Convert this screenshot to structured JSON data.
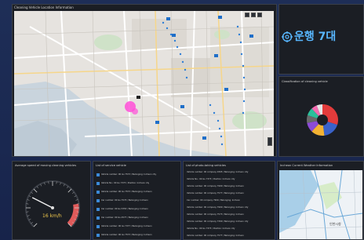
{
  "map": {
    "title": "Cleaning Vehicle Location Information",
    "colors": {
      "route": "#2f7fd6",
      "highlight": "#ff4fd8",
      "marker": "#1f6fc9"
    }
  },
  "ops": {
    "label": "운행 7대",
    "icon": "target-icon",
    "color": "#58b7ff"
  },
  "classification": {
    "title": "Classification of cleaning vehicle",
    "chart_data": {
      "type": "pie",
      "values": [
        30,
        18,
        14,
        10,
        8,
        8,
        6,
        6
      ],
      "colors": [
        "#e23b3b",
        "#3a62c9",
        "#f3b233",
        "#8c4bd6",
        "#6a6a6a",
        "#2bbf9b",
        "#f26bb0",
        "#e6e6e6"
      ]
    }
  },
  "speed": {
    "title": "Average speed of moving cleaning vehicles",
    "value": 16,
    "unit": "km/h",
    "display": "16 km/h",
    "max": 60,
    "accent": "#e05a5a"
  },
  "service": {
    "title": "List of service vehicle",
    "rows": [
      "Vehicle number: 00 Gu 7573 / Belonging: Incheon city",
      "Vehicle No.: 00 Gu 7373 / Position: Incheon city",
      "Vehicle number: 00 Gu 7573 / Belonging: Incheon",
      "Car number: 00 Gu 7573 / Belonging: Incheon",
      "Car number: 00 Gu 5353 / Belonging: Incheon",
      "Car number: 00 Gu 4577 / Belonging: Incheon",
      "Vehicle number: 00 Gu 7377 / Belonging: Incheon",
      "Vehicle number: 00 Gu 7573 / Belonging: Incheon"
    ]
  },
  "photo": {
    "title": "List of photo-taking vehicles",
    "rows": [
      "Vehicle number: 00 company 0305 / Belonging: Incheon city",
      "Vehicle No.: 00 Gu 7373 / Position: Incheon city",
      "Vehicle number: 00 company 7900 / Belonging: Incheon",
      "Vehicle number: 00 company 7577 / Belonging: Incheon",
      "Car number: 00 company 7900 / Belonging: Incheon",
      "Vehicle number: 00 company 7900 / Belonging: Incheon city",
      "Vehicle number: 00 company 7573 / Belonging: Incheon",
      "Vehicle number: 00 company 7300 / Belonging: Incheon city",
      "Vehicle No.: 00 Gu 7373 / Position: Incheon city",
      "Vehicle number: 00 company 7577 / Belonging: Incheon"
    ]
  },
  "weather": {
    "title": "Incheon Current Weather Information",
    "map_label": "인천시청"
  }
}
